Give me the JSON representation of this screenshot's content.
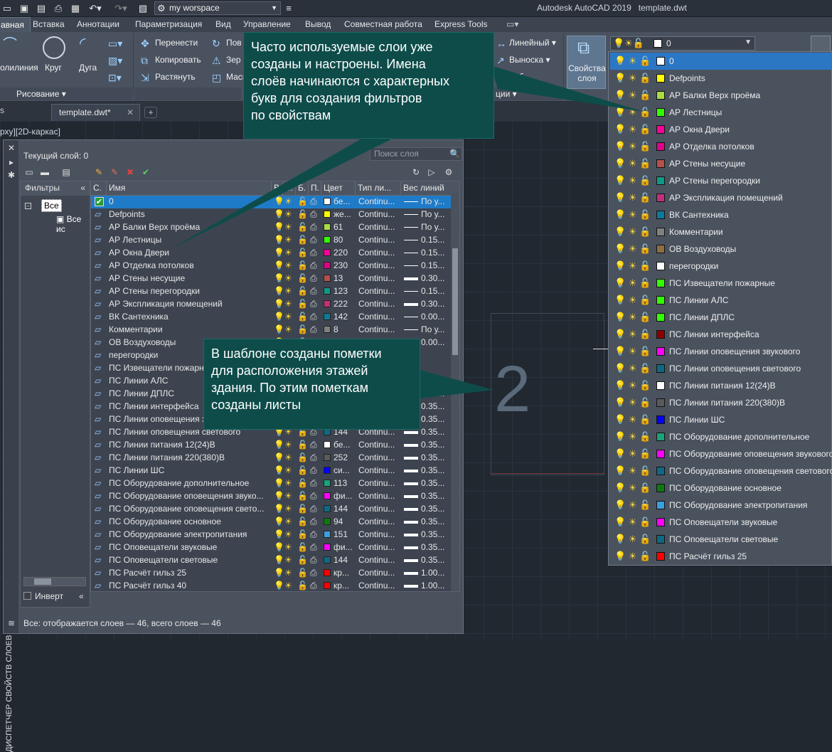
{
  "app": {
    "title": "Autodesk AutoCAD 2019",
    "file": "template.dwt",
    "workspace": "my worspace"
  },
  "ribbon_tabs": [
    "авная",
    "Вставка",
    "Аннотации",
    "Параметризация",
    "Вид",
    "Управление",
    "Вывод",
    "Совместная работа",
    "Express Tools"
  ],
  "ribbon": {
    "line": "олилиния",
    "circle": "Круг",
    "arc": "Дуга",
    "draw_panel": "Рисование",
    "move": "Перенести",
    "copy": "Копировать",
    "stretch": "Растянуть",
    "rotate": "Пов",
    "mirror": "Зер",
    "scale": "Масшт",
    "linear": "Линейный",
    "leader": "Выноска",
    "table": "Таб",
    "annot_panel": "ции",
    "layer_props": "Свойства слоя",
    "layer_combo": "0"
  },
  "doc_tab": "template.dwt*",
  "viewport_label": "рху][2D-каркас]",
  "drawing_number": "2",
  "layer_manager": {
    "current_layer": "Текущий слой: 0",
    "search_placeholder": "Поиск слоя",
    "filters_header": "Фильтры",
    "filter_all": "Все",
    "filter_used": "Все ис",
    "invert": "Инверт",
    "side_title": "ДИСПЕТЧЕР СВОЙСТВ СЛОЕВ",
    "status": "Все: отображается слоев — 46, всего слоев — 46",
    "columns": [
      "С.",
      "Имя",
      "В.",
      "З.",
      "Б.",
      "П.",
      "Цвет",
      "Тип ли...",
      "Вес линий"
    ],
    "rows": [
      {
        "name": "0",
        "color": "бе...",
        "hex": "#ffffff",
        "ltype": "Continu...",
        "lw": "По у...",
        "thick": false
      },
      {
        "name": "Defpoints",
        "color": "же...",
        "hex": "#ffff00",
        "ltype": "Continu...",
        "lw": "По у...",
        "thick": false
      },
      {
        "name": "АР Балки Верх проёма",
        "color": "61",
        "hex": "#aadc44",
        "ltype": "Continu...",
        "lw": "По у...",
        "thick": false
      },
      {
        "name": "АР Лестницы",
        "color": "80",
        "hex": "#33ff00",
        "ltype": "Continu...",
        "lw": "0.15...",
        "thick": false
      },
      {
        "name": "АР Окна Двери",
        "color": "220",
        "hex": "#ff0099",
        "ltype": "Continu...",
        "lw": "0.15...",
        "thick": false
      },
      {
        "name": "АР Отделка потолков",
        "color": "230",
        "hex": "#e0008a",
        "ltype": "Continu...",
        "lw": "0.15...",
        "thick": false
      },
      {
        "name": "АР Стены несущие",
        "color": "13",
        "hex": "#b5504a",
        "ltype": "Continu...",
        "lw": "0.30...",
        "thick": true
      },
      {
        "name": "АР Стены перегородки",
        "color": "123",
        "hex": "#0d9a86",
        "ltype": "Continu...",
        "lw": "0.15...",
        "thick": false
      },
      {
        "name": "АР Экспликация помещений",
        "color": "222",
        "hex": "#c0307a",
        "ltype": "Continu...",
        "lw": "0.30...",
        "thick": true
      },
      {
        "name": "ВК Сантехника",
        "color": "142",
        "hex": "#0e7a9a",
        "ltype": "Continu...",
        "lw": "0.00...",
        "thick": false
      },
      {
        "name": "Комментарии",
        "color": "8",
        "hex": "#808080",
        "ltype": "Continu...",
        "lw": "По у...",
        "thick": false
      },
      {
        "name": "ОВ Воздуховоды",
        "color": "",
        "hex": "",
        "ltype": "",
        "lw": "0.00...",
        "thick": false
      },
      {
        "name": "перегородки",
        "color": "",
        "hex": "",
        "ltype": "",
        "lw": "",
        "thick": false
      },
      {
        "name": "ПС Извещатели пожарны",
        "color": "",
        "hex": "",
        "ltype": "",
        "lw": "",
        "thick": false
      },
      {
        "name": "ПС Линии АЛС",
        "color": "",
        "hex": "",
        "ltype": "",
        "lw": "0.35...",
        "thick": true
      },
      {
        "name": "ПС Линии ДПЛС",
        "color": "",
        "hex": "",
        "ltype": "",
        "lw": "0.35...",
        "thick": true
      },
      {
        "name": "ПС Линии интерфейса",
        "color": "",
        "hex": "",
        "ltype": "",
        "lw": "0.35...",
        "thick": true
      },
      {
        "name": "ПС Линии оповещения зв",
        "color": "",
        "hex": "",
        "ltype": "",
        "lw": "0.35...",
        "thick": true
      },
      {
        "name": "ПС Линии оповещения светового",
        "color": "144",
        "hex": "#0e6a84",
        "ltype": "Continu...",
        "lw": "0.35...",
        "thick": true
      },
      {
        "name": "ПС Линии питания 12(24)В",
        "color": "бе...",
        "hex": "#ffffff",
        "ltype": "Continu...",
        "lw": "0.35...",
        "thick": true
      },
      {
        "name": "ПС Линии питания 220(380)В",
        "color": "252",
        "hex": "#5a5a5a",
        "ltype": "Continu...",
        "lw": "0.35...",
        "thick": true
      },
      {
        "name": "ПС Линии ШС",
        "color": "си...",
        "hex": "#0000ff",
        "ltype": "Continu...",
        "lw": "0.35...",
        "thick": true
      },
      {
        "name": "ПС Оборудование дополнительное",
        "color": "113",
        "hex": "#1aa37a",
        "ltype": "Continu...",
        "lw": "0.35...",
        "thick": true
      },
      {
        "name": "ПС  Оборудование  оповещения  звуко...",
        "color": "фи...",
        "hex": "#ff00ff",
        "ltype": "Continu...",
        "lw": "0.35...",
        "thick": true
      },
      {
        "name": "ПС  Оборудование  оповещения  свето...",
        "color": "144",
        "hex": "#0e6a84",
        "ltype": "Continu...",
        "lw": "0.35...",
        "thick": true
      },
      {
        "name": "ПС Оборудование основное",
        "color": "94",
        "hex": "#0e7a0e",
        "ltype": "Continu...",
        "lw": "0.35...",
        "thick": true
      },
      {
        "name": "ПС Оборудование электропитания",
        "color": "151",
        "hex": "#3aa0e0",
        "ltype": "Continu...",
        "lw": "0.35...",
        "thick": true
      },
      {
        "name": "ПС Оповещатели звуковые",
        "color": "фи...",
        "hex": "#ff00ff",
        "ltype": "Continu...",
        "lw": "0.35...",
        "thick": true
      },
      {
        "name": "ПС Оповещатели световые",
        "color": "144",
        "hex": "#0e6a84",
        "ltype": "Continu...",
        "lw": "0.35...",
        "thick": true
      },
      {
        "name": "ПС Расчёт гильз 25",
        "color": "кр...",
        "hex": "#ff0000",
        "ltype": "Continu...",
        "lw": "1.00...",
        "thick": true
      },
      {
        "name": "ПС Расчёт гильз 40",
        "color": "кр...",
        "hex": "#ff0000",
        "ltype": "Continu...",
        "lw": "1.00...",
        "thick": true
      }
    ]
  },
  "layer_dropdown": [
    {
      "name": "0",
      "hex": "#ffffff"
    },
    {
      "name": "Defpoints",
      "hex": "#ffff00"
    },
    {
      "name": "АР Балки Верх проёма",
      "hex": "#aadc44"
    },
    {
      "name": "АР Лестницы",
      "hex": "#33ff00"
    },
    {
      "name": "АР Окна Двери",
      "hex": "#ff0099"
    },
    {
      "name": "АР Отделка потолков",
      "hex": "#e0008a"
    },
    {
      "name": "АР Стены несущие",
      "hex": "#b5504a"
    },
    {
      "name": "АР Стены перегородки",
      "hex": "#0d9a86"
    },
    {
      "name": "АР Экспликация помещений",
      "hex": "#c0307a"
    },
    {
      "name": "ВК Сантехника",
      "hex": "#0e7a9a"
    },
    {
      "name": "Комментарии",
      "hex": "#808080"
    },
    {
      "name": "ОВ Воздуховоды",
      "hex": "#8a7040"
    },
    {
      "name": "перегородки",
      "hex": "#ffffff"
    },
    {
      "name": "ПС Извещатели пожарные",
      "hex": "#33ff00"
    },
    {
      "name": "ПС Линии АЛС",
      "hex": "#33ff00"
    },
    {
      "name": "ПС Линии ДПЛС",
      "hex": "#33ff00"
    },
    {
      "name": "ПС Линии интерфейса",
      "hex": "#8a0000"
    },
    {
      "name": "ПС Линии оповещения звукового",
      "hex": "#ff00ff"
    },
    {
      "name": "ПС Линии оповещения светового",
      "hex": "#0e6a84"
    },
    {
      "name": "ПС Линии питания 12(24)В",
      "hex": "#ffffff"
    },
    {
      "name": "ПС Линии питания 220(380)В",
      "hex": "#5a5a5a"
    },
    {
      "name": "ПС Линии ШС",
      "hex": "#0000ff"
    },
    {
      "name": "ПС Оборудование дополнительное",
      "hex": "#1aa37a"
    },
    {
      "name": "ПС Оборудование оповещения звукового",
      "hex": "#ff00ff"
    },
    {
      "name": "ПС Оборудование оповещения светового",
      "hex": "#0e6a84"
    },
    {
      "name": "ПС Оборудование основное",
      "hex": "#0e7a0e"
    },
    {
      "name": "ПС Оборудование электропитания",
      "hex": "#3aa0e0"
    },
    {
      "name": "ПС Оповещатели звуковые",
      "hex": "#ff00ff"
    },
    {
      "name": "ПС Оповещатели световые",
      "hex": "#0e6a84"
    },
    {
      "name": "ПС Расчёт гильз 25",
      "hex": "#ff0000"
    }
  ],
  "callouts": {
    "top": [
      "Часто используемые слои уже",
      "созданы и настроены. Имена",
      "слоёв начинаются с характерных",
      "букв для создания фильтров",
      "по свойствам"
    ],
    "bottom": [
      "В шаблоне созданы пометки",
      "для расположения этажей",
      "здания. По этим пометкам",
      "созданы листы"
    ]
  },
  "colors": {
    "accent": "#1f7bc8",
    "callout_bg": "#0e4c4a"
  }
}
